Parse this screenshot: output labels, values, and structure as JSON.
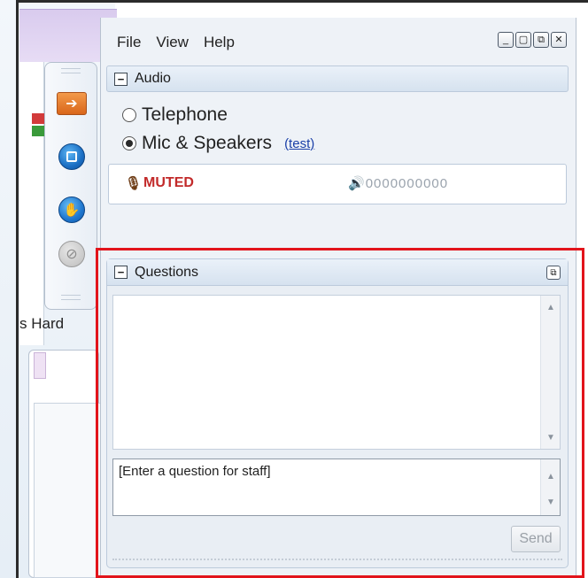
{
  "menu": {
    "file": "File",
    "view": "View",
    "help": "Help"
  },
  "window_buttons": {
    "minimize": "_",
    "restore": "▢",
    "popout": "⧉",
    "close": "✕"
  },
  "audio": {
    "title": "Audio",
    "collapse_symbol": "−",
    "options": [
      {
        "label": "Telephone",
        "selected": false
      },
      {
        "label": "Mic & Speakers",
        "selected": true
      }
    ],
    "test_link": "(test)",
    "status": "MUTED",
    "volume_level": "0000000000"
  },
  "questions": {
    "title": "Questions",
    "collapse_symbol": "−",
    "input_placeholder": "[Enter a question for staff]",
    "send_label": "Send"
  },
  "background": {
    "partial_label": "s Hard"
  },
  "colors": {
    "muted": "#c22a2a",
    "link": "#1a3fa8",
    "highlight": "#e2141b",
    "panel_bg": "#eef2f7"
  },
  "icons": {
    "mic": "microphone-icon",
    "speaker": "speaker-icon",
    "arrow": "arrow-right-icon",
    "stop": "stop-icon",
    "hand": "raise-hand-icon",
    "disabled": "disabled-icon"
  }
}
